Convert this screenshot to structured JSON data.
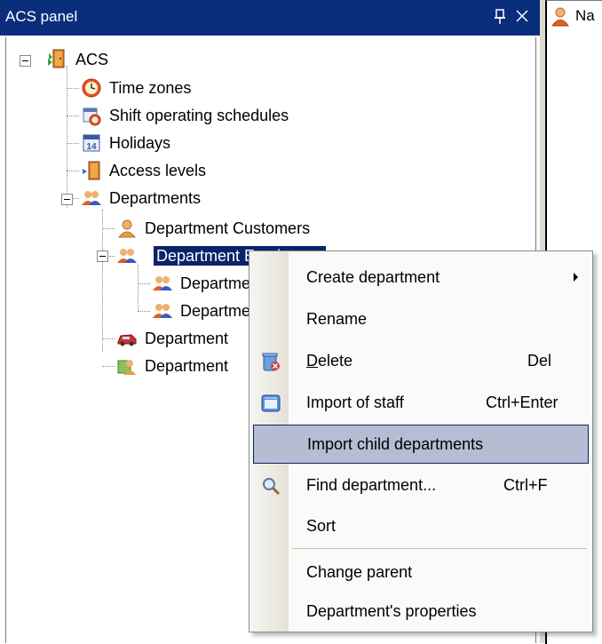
{
  "panel": {
    "title": "ACS panel"
  },
  "doc_tab": {
    "label": "Na"
  },
  "tree": {
    "root": "ACS",
    "time_zones": "Time zones",
    "shift_schedules": "Shift operating schedules",
    "holidays": "Holidays",
    "access_levels": "Access levels",
    "departments": "Departments",
    "dept_customers": "Department Customers",
    "dept_employees": "Department Employees",
    "dept_child1": "Department",
    "dept_child2": "Department",
    "dept_other1": "Department",
    "dept_other2": "Department"
  },
  "context_menu": {
    "create_department": "Create department",
    "rename": "Rename",
    "delete_prefix": "D",
    "delete_rest": "elete",
    "delete_shortcut": "Del",
    "import_staff": "Import of staff",
    "import_staff_shortcut": "Ctrl+Enter",
    "import_child": "Import child departments",
    "find_department": "Find department...",
    "find_shortcut": "Ctrl+F",
    "sort": "Sort",
    "change_parent": "Change parent",
    "properties": "Department's properties"
  },
  "colors": {
    "title_bar": "#0a2e7c",
    "selection": "#0a246a",
    "menu_highlight": "#b6bdd2"
  }
}
